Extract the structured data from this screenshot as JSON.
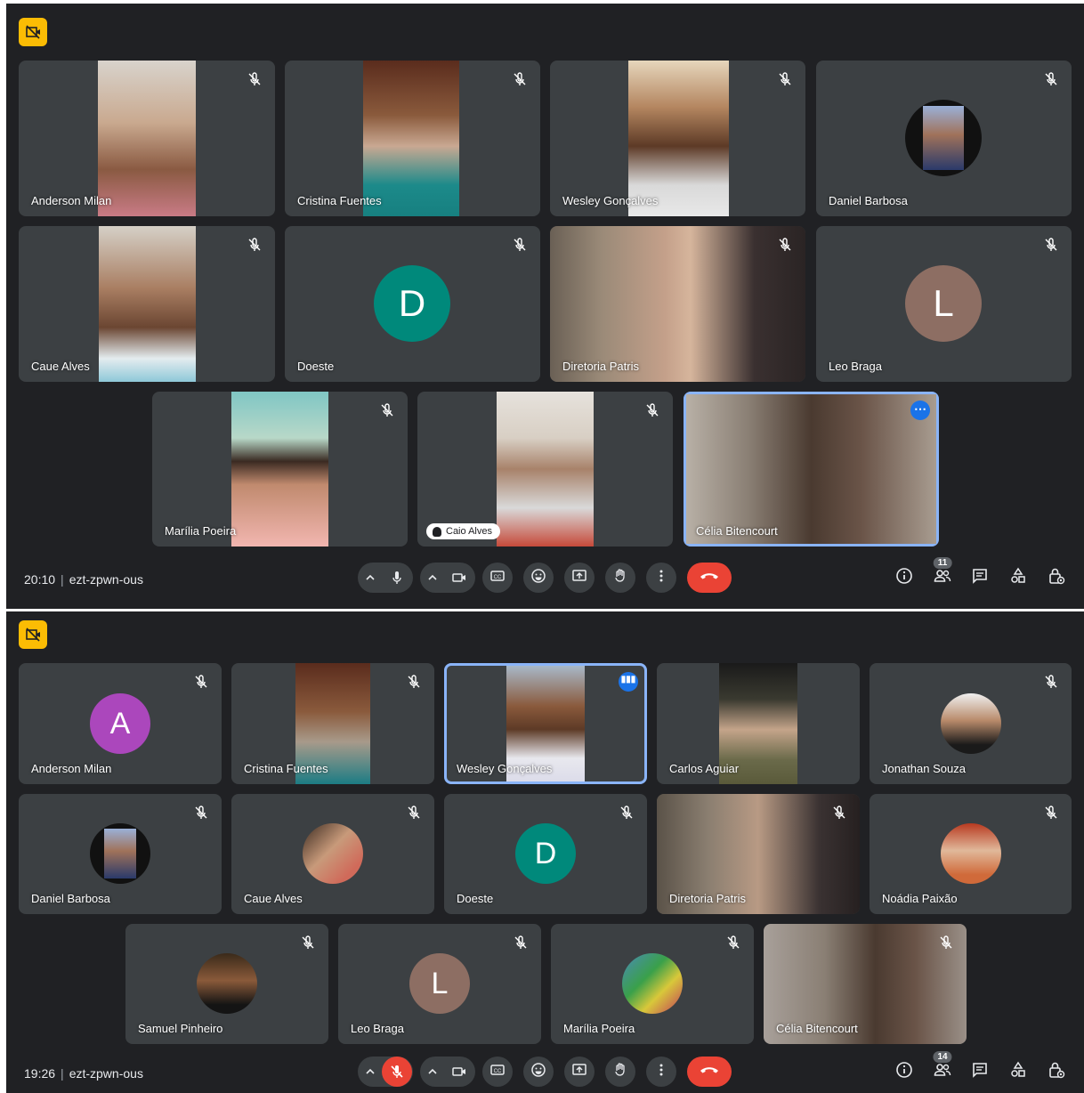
{
  "screens": [
    {
      "time": "20:10",
      "meeting_code": "ezt-zpwn-ous",
      "participant_count": "11",
      "participants": [
        {
          "name": "Anderson Milan",
          "muted": true
        },
        {
          "name": "Cristina Fuentes",
          "muted": true
        },
        {
          "name": "Wesley Gonçalves",
          "muted": true
        },
        {
          "name": "Daniel Barbosa",
          "muted": true
        },
        {
          "name": "Caue Alves",
          "muted": true
        },
        {
          "name": "Doeste",
          "muted": true,
          "avatar_letter": "D",
          "avatar_color": "#00897b"
        },
        {
          "name": "Diretoria Patris",
          "muted": true
        },
        {
          "name": "Leo Braga",
          "muted": true,
          "avatar_letter": "L",
          "avatar_color": "#8d6e63"
        },
        {
          "name": "Marília Poeira",
          "muted": true
        },
        {
          "name": "Caio Alves",
          "muted": true
        },
        {
          "name": "Célia Bitencourt",
          "muted": false,
          "speaking": true
        }
      ]
    },
    {
      "time": "19:26",
      "meeting_code": "ezt-zpwn-ous",
      "participant_count": "14",
      "participants": [
        {
          "name": "Anderson Milan",
          "muted": true,
          "avatar_letter": "A",
          "avatar_color": "#ab47bc"
        },
        {
          "name": "Cristina Fuentes",
          "muted": true
        },
        {
          "name": "Wesley Gonçalves",
          "muted": false,
          "speaking": true
        },
        {
          "name": "Carlos Aguiar",
          "muted": false
        },
        {
          "name": "Jonathan Souza",
          "muted": true
        },
        {
          "name": "Daniel Barbosa",
          "muted": true
        },
        {
          "name": "Caue Alves",
          "muted": true
        },
        {
          "name": "Doeste",
          "muted": true,
          "avatar_letter": "D",
          "avatar_color": "#00897b"
        },
        {
          "name": "Diretoria Patris",
          "muted": true
        },
        {
          "name": "Noádia Paixão",
          "muted": true
        },
        {
          "name": "Samuel Pinheiro",
          "muted": true
        },
        {
          "name": "Leo Braga",
          "muted": true,
          "avatar_letter": "L",
          "avatar_color": "#8d6e63"
        },
        {
          "name": "Marília Poeira",
          "muted": true
        },
        {
          "name": "Célia Bitencourt",
          "muted": true
        }
      ]
    }
  ],
  "colors": {
    "background": "#202124",
    "tile": "#3c4043",
    "accent": "#8ab4f8",
    "hangup": "#ea4335",
    "recording": "#fbbc04"
  },
  "icons": [
    "recording-icon",
    "mic-off-icon",
    "mic-icon",
    "camera-icon",
    "captions-icon",
    "emoji-icon",
    "present-icon",
    "raise-hand-icon",
    "more-options-icon",
    "end-call-icon",
    "info-icon",
    "people-icon",
    "chat-icon",
    "activities-icon",
    "host-controls-icon"
  ]
}
